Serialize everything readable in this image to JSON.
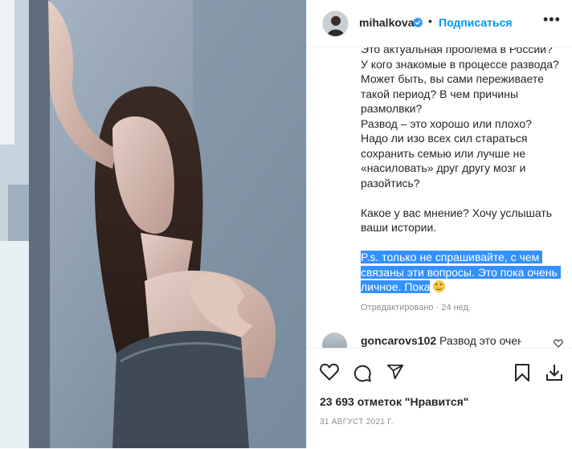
{
  "post": {
    "username": "mihalkova",
    "separator": "•",
    "follow_label": "Подписаться",
    "more_label": "•••",
    "caption_before": "Это актуальная проблема в России?\nУ кого знакомые в процессе развода?\nМожет быть, вы сами переживаете такой период? В чем причины размолвки?\nРазвод – это хорошо или плохо?\nНадо ли изо всех сил стараться сохранить семью или лучше не «насиловать» друг другу мозг и разойтись?\n\nКакое у вас мнение? Хочу услышать ваши истории.\n\n",
    "caption_selected": "P.s. только не спрашивайте, с чем связаны эти вопросы. Это пока очень личное. Пока",
    "edited_label": "Отредактировано · 24 нед.",
    "comment_user": "goncarovs102",
    "comment_text": " Развод это очень",
    "likes": "23 693 отметок \"Нравится\"",
    "date": "31 АВГУСТ 2021 Г."
  },
  "icons": [
    "verified-icon",
    "more-icon",
    "heart-icon",
    "comment-icon",
    "share-icon",
    "save-icon",
    "download-icon",
    "smiley-emoji"
  ],
  "colors": {
    "accent": "#0095f6",
    "text": "#262626",
    "muted": "#8e8e8e",
    "selection": "#3390ff"
  }
}
